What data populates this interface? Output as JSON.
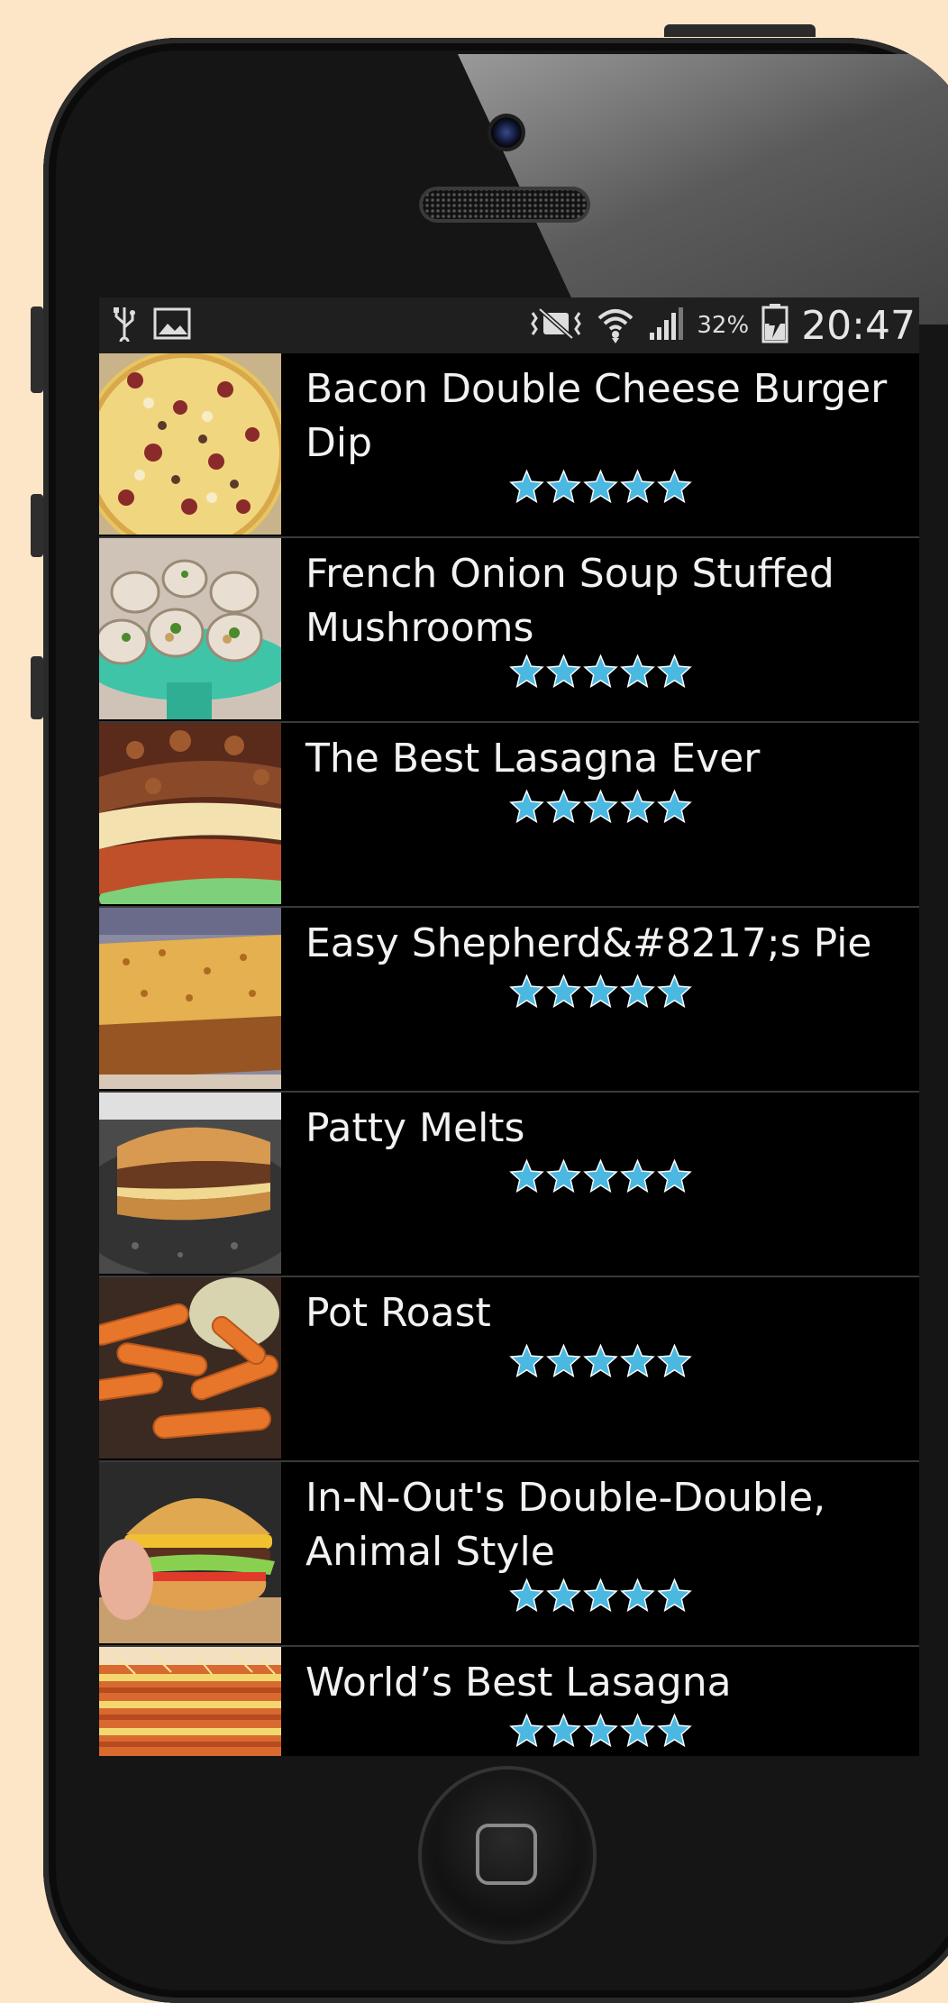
{
  "status_bar": {
    "left_icons": [
      "usb-icon",
      "image-icon"
    ],
    "right_icons": [
      "vibrate-icon",
      "wifi-icon",
      "signal-icon",
      "battery-charging-icon"
    ],
    "battery_percent": "32%",
    "time": "20:47"
  },
  "colors": {
    "star": "#4bb8e2",
    "background": "#fde6c8",
    "list_bg": "#000000",
    "divider": "#3a3a3a"
  },
  "recipes": [
    {
      "title": "Bacon Double Cheese Burger Dip",
      "rating": 5
    },
    {
      "title": "French Onion Soup Stuffed Mushrooms",
      "rating": 5
    },
    {
      "title": "The Best Lasagna Ever",
      "rating": 5
    },
    {
      "title": "Easy Shepherd&#8217;s Pie",
      "rating": 5
    },
    {
      "title": "Patty Melts",
      "rating": 5
    },
    {
      "title": "Pot Roast",
      "rating": 5
    },
    {
      "title": "In-N-Out's Double-Double, Animal Style",
      "rating": 5
    },
    {
      "title": "World’s Best Lasagna",
      "rating": 5
    }
  ]
}
